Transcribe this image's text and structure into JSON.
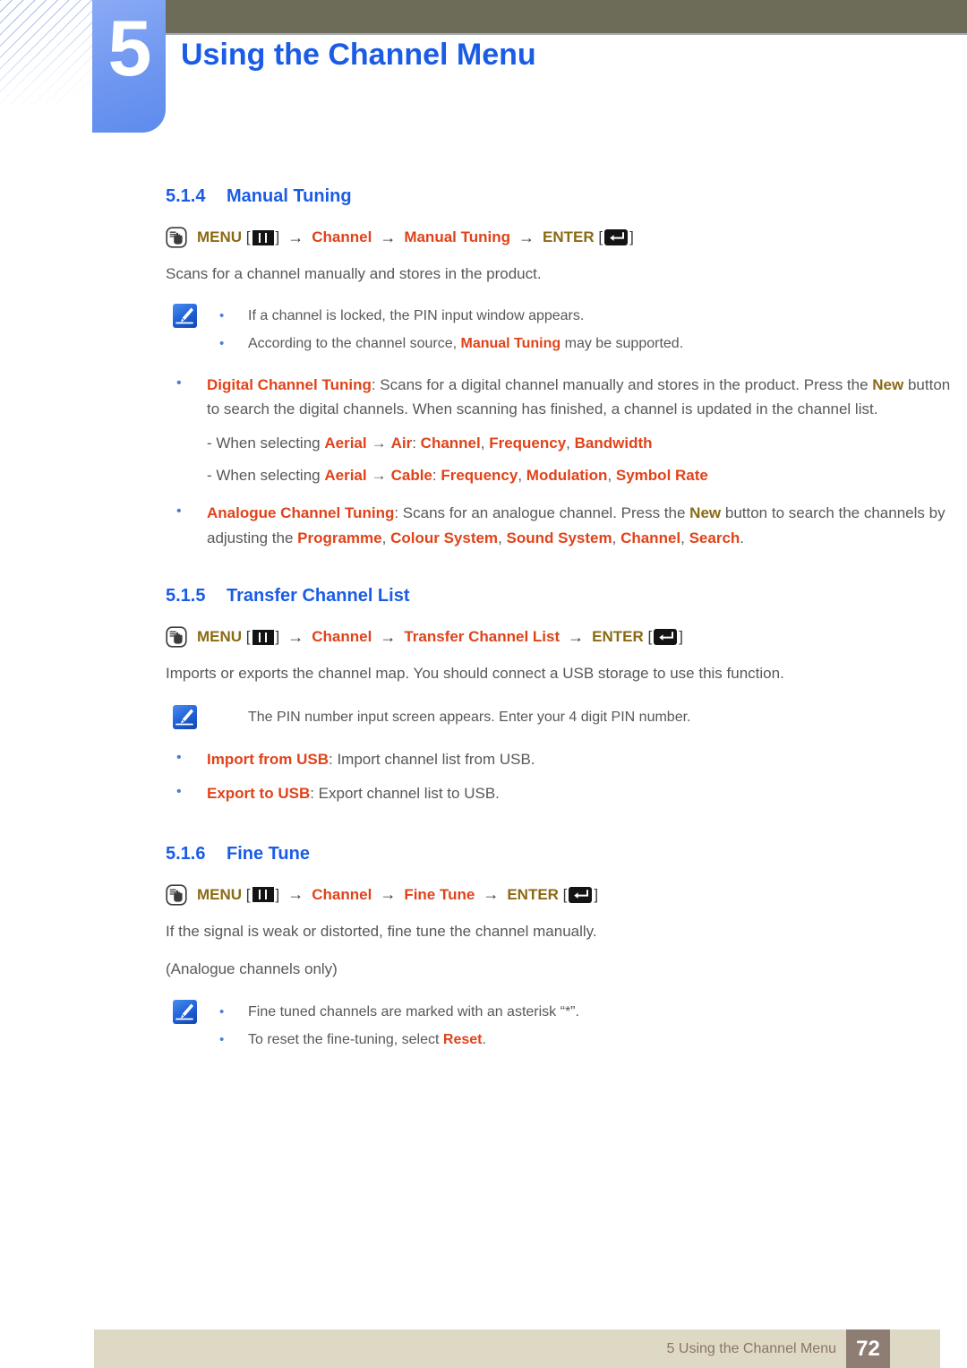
{
  "header": {
    "chapter_number": "5",
    "title": "Using the Channel Menu",
    "accent_blue": "#1a5ce5",
    "tab_blue": "#6f97f0",
    "bar_olive": "#6d6c58"
  },
  "colors": {
    "heading_blue": "#1a5ce5",
    "menu_olive": "#8a6a14",
    "term_red": "#e0431a",
    "body_gray": "#58585a",
    "bullet_blue": "#4a7fd4",
    "footer_bar": "#ded9c4",
    "footer_page_box": "#8e7d73"
  },
  "sections": [
    {
      "number": "5.1.4",
      "title": "Manual Tuning",
      "menu_path": {
        "hand_icon": "hand-press-icon",
        "menu_label": "MENU",
        "menu_glyph": "menu-button-glyph",
        "arrow": "→",
        "steps": [
          "Channel",
          "Manual Tuning"
        ],
        "enter_label": "ENTER",
        "enter_glyph": "enter-button-glyph",
        "bracket_open": "[",
        "bracket_close": "]"
      },
      "intro": "Scans for a channel manually and stores in the product.",
      "note": {
        "icon": "note-pencil-icon",
        "lines": [
          {
            "segments": [
              {
                "t": "If a channel is locked, the PIN input window appears.",
                "s": "plain"
              }
            ]
          },
          {
            "segments": [
              {
                "t": "According to the channel source, ",
                "s": "plain"
              },
              {
                "t": "Manual Tuning",
                "s": "red"
              },
              {
                "t": " may be supported.",
                "s": "plain"
              }
            ]
          }
        ]
      },
      "bullets": [
        {
          "segments": [
            {
              "t": "Digital Channel Tuning",
              "s": "red"
            },
            {
              "t": ": Scans for a digital channel manually and stores in the product. Press the ",
              "s": "plain"
            },
            {
              "t": "New",
              "s": "olive"
            },
            {
              "t": " button to search the digital channels. When scanning has finished, a channel is updated in the channel list.",
              "s": "plain"
            }
          ]
        }
      ],
      "sub_lines": [
        {
          "segments": [
            {
              "t": "- When selecting ",
              "s": "plain"
            },
            {
              "t": "Aerial",
              "s": "red"
            },
            {
              "t": "→",
              "s": "arrow"
            },
            {
              "t": "Air",
              "s": "red"
            },
            {
              "t": ": ",
              "s": "plain"
            },
            {
              "t": "Channel",
              "s": "red"
            },
            {
              "t": ", ",
              "s": "plain"
            },
            {
              "t": "Frequency",
              "s": "red"
            },
            {
              "t": ", ",
              "s": "plain"
            },
            {
              "t": "Bandwidth",
              "s": "red"
            }
          ]
        },
        {
          "segments": [
            {
              "t": "- When selecting ",
              "s": "plain"
            },
            {
              "t": "Aerial",
              "s": "red"
            },
            {
              "t": "→",
              "s": "arrow"
            },
            {
              "t": "Cable",
              "s": "red"
            },
            {
              "t": ": ",
              "s": "plain"
            },
            {
              "t": "Frequency",
              "s": "red"
            },
            {
              "t": ", ",
              "s": "plain"
            },
            {
              "t": "Modulation",
              "s": "red"
            },
            {
              "t": ", ",
              "s": "plain"
            },
            {
              "t": "Symbol Rate",
              "s": "red"
            }
          ]
        }
      ],
      "bullets2": [
        {
          "segments": [
            {
              "t": "Analogue Channel Tuning",
              "s": "red"
            },
            {
              "t": ": Scans for an analogue channel. Press the ",
              "s": "plain"
            },
            {
              "t": "New",
              "s": "olive"
            },
            {
              "t": " button to search the channels by adjusting the ",
              "s": "plain"
            },
            {
              "t": "Programme",
              "s": "red"
            },
            {
              "t": ", ",
              "s": "plain"
            },
            {
              "t": "Colour System",
              "s": "red"
            },
            {
              "t": ", ",
              "s": "plain"
            },
            {
              "t": "Sound System",
              "s": "red"
            },
            {
              "t": ", ",
              "s": "plain"
            },
            {
              "t": "Channel",
              "s": "red"
            },
            {
              "t": ", ",
              "s": "plain"
            },
            {
              "t": "Search",
              "s": "red"
            },
            {
              "t": ".",
              "s": "plain"
            }
          ]
        }
      ]
    },
    {
      "number": "5.1.5",
      "title": "Transfer Channel List",
      "menu_path": {
        "hand_icon": "hand-press-icon",
        "menu_label": "MENU",
        "menu_glyph": "menu-button-glyph",
        "arrow": "→",
        "steps": [
          "Channel",
          "Transfer Channel List"
        ],
        "enter_label": "ENTER",
        "enter_glyph": "enter-button-glyph",
        "bracket_open": "[",
        "bracket_close": "]"
      },
      "intro": "Imports or exports the channel map. You should connect a USB storage to use this function.",
      "note": {
        "icon": "note-pencil-icon",
        "plain_line": "The PIN number input screen appears. Enter your 4 digit PIN number."
      },
      "bullets": [
        {
          "segments": [
            {
              "t": "Import from USB",
              "s": "red"
            },
            {
              "t": ": Import channel list from USB.",
              "s": "plain"
            }
          ]
        },
        {
          "segments": [
            {
              "t": "Export to USB",
              "s": "red"
            },
            {
              "t": ": Export channel list to USB.",
              "s": "plain"
            }
          ]
        }
      ]
    },
    {
      "number": "5.1.6",
      "title": "Fine Tune",
      "menu_path": {
        "hand_icon": "hand-press-icon",
        "menu_label": "MENU",
        "menu_glyph": "menu-button-glyph",
        "arrow": "→",
        "steps": [
          "Channel",
          "Fine Tune"
        ],
        "enter_label": "ENTER",
        "enter_glyph": "enter-button-glyph",
        "bracket_open": "[",
        "bracket_close": "]"
      },
      "intro": "If the signal is weak or distorted, fine tune the channel manually.",
      "intro2": "(Analogue channels only)",
      "note": {
        "icon": "note-pencil-icon",
        "lines": [
          {
            "segments": [
              {
                "t": "Fine tuned channels are marked with an asterisk “*”.",
                "s": "plain"
              }
            ]
          },
          {
            "segments": [
              {
                "t": "To reset the fine-tuning, select ",
                "s": "plain"
              },
              {
                "t": "Reset",
                "s": "red"
              },
              {
                "t": ".",
                "s": "plain"
              }
            ]
          }
        ]
      }
    }
  ],
  "footer": {
    "text": "5 Using the Channel Menu",
    "page_number": "72"
  }
}
